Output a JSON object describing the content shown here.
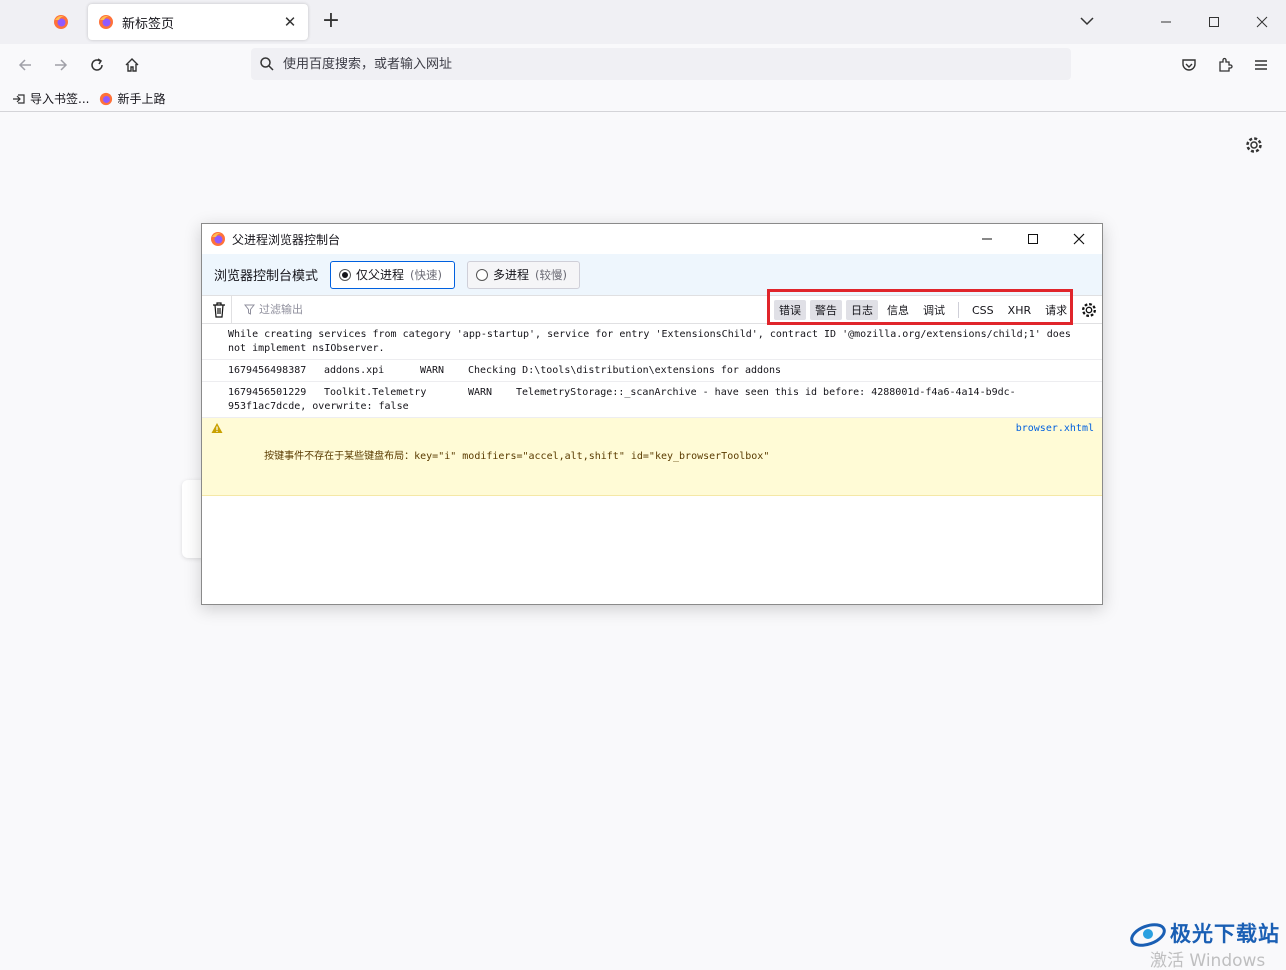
{
  "browser": {
    "tab": {
      "title": "新标签页"
    },
    "urlbar": {
      "placeholder": "使用百度搜索，或者输入网址"
    },
    "bookmarks": [
      {
        "label": "导入书签...",
        "icon": "import-icon"
      },
      {
        "label": "新手上路",
        "icon": "firefox-icon"
      }
    ]
  },
  "console": {
    "title": "父进程浏览器控制台",
    "mode_label": "浏览器控制台模式",
    "modes": [
      {
        "label": "仅父进程",
        "hint": "(快速)",
        "selected": true
      },
      {
        "label": "多进程",
        "hint": "(较慢)",
        "selected": false
      }
    ],
    "filter_placeholder": "过滤输出",
    "filters": [
      {
        "label": "错误",
        "on": true
      },
      {
        "label": "警告",
        "on": true
      },
      {
        "label": "日志",
        "on": true
      },
      {
        "label": "信息",
        "on": false
      },
      {
        "label": "调试",
        "on": false
      },
      {
        "label": "CSS",
        "on": false
      },
      {
        "label": "XHR",
        "on": false
      },
      {
        "label": "请求",
        "on": false
      }
    ],
    "messages": [
      {
        "text": "While creating services from category 'app-startup', service for entry 'ExtensionsChild', contract ID '@mozilla.org/extensions/child;1' does not implement nsIObserver."
      },
      {
        "timestamp": "1679456498387",
        "source": "addons.xpi",
        "level": "WARN",
        "text": "Checking D:\\tools\\distribution\\extensions for addons"
      },
      {
        "timestamp": "1679456501229",
        "source": "Toolkit.Telemetry",
        "level": "WARN",
        "text": "TelemetryStorage::_scanArchive - have seen this id before: 4288001d-f4a6-4a14-b9dc-953f1ac7dcde, overwrite: false"
      },
      {
        "warning": "按键事件不存在于某些键盘布局：key=\"i\" modifiers=\"accel,alt,shift\" id=\"key_browserToolbox\"",
        "link": "browser.xhtml"
      }
    ],
    "highlight_color": "#e0252b"
  },
  "watermark": {
    "title": "极光下载站",
    "sub": "激活 Windows"
  },
  "colors": {
    "accent": "#0060df",
    "warning_bg": "#fffbd6"
  }
}
